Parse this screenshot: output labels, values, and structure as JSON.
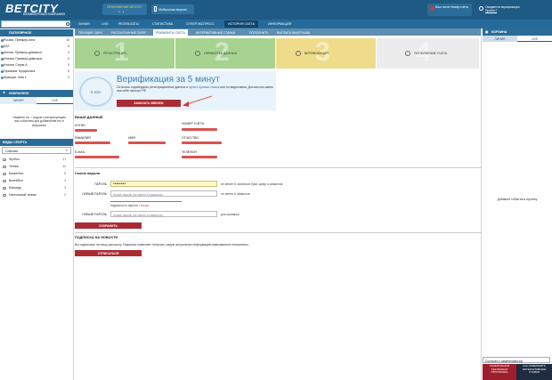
{
  "header": {
    "logo": "BETCITY",
    "logo_sub": "БУКМЕКЕРСКАЯ КОМПАНИЯ",
    "promo_label": "ПРИЛОЖЕНИЕ BETCITY",
    "mobile_label": "Мобильная версия",
    "user_text": "Ваш логин  Номер счета",
    "verify_text": "Ожидается верификация.",
    "verify_sub": "Пройти?"
  },
  "topnav": {
    "search_placeholder": "",
    "items": [
      "ЛИНИЯ",
      "LIVE",
      "РЕЗУЛЬТАТЫ",
      "СТАТИСТИКА",
      "СУПЕРЭКСПРЕСС",
      "ИСТОРИЯ СЧЁТА",
      "ИНФОРМАЦИЯ"
    ]
  },
  "subnav": {
    "items": [
      "ТЕКУЩИЕ ПАРИ",
      "РАССЧИТАННЫЕ ПАРИ",
      "РЕКВИЗИТЫ СЧЁТА",
      "ИНТЕРАКТИВНЫЕ СТАВКИ",
      "ПОПОЛНИТЬ",
      "ВЫПЛАТА ВЫИГРЫША"
    ]
  },
  "sidebar": {
    "popular_title": "ПОПУЛЯРНОЕ",
    "popular": [
      {
        "label": "Россия. Премьер-лига",
        "count": "18"
      },
      {
        "label": "КХЛ",
        "count": "8"
      },
      {
        "label": "Англия. Премьер-дивизион",
        "count": "6"
      },
      {
        "label": "Италия. Премьер-дивизион",
        "count": "6"
      },
      {
        "label": "Италия. Серия А",
        "count": "5"
      },
      {
        "label": "Германия. Бундеслига",
        "count": "5"
      },
      {
        "label": "Франция. Лига 1",
        "count": "3"
      }
    ],
    "favorites_title": "ИЗБРАННОЕ",
    "tab_line": "ЛИНИЯ",
    "tab_live": "LIVE",
    "note": "Нажмите на ☆ рядом с интересующим вас событием для добавления его в избранное",
    "sports_title": "ВИДЫ СПОРТА",
    "select_value": "События",
    "sports": [
      {
        "label": "Футбол",
        "count": "17"
      },
      {
        "label": "Теннис",
        "count": "12"
      },
      {
        "label": "Баскетбол",
        "count": "5"
      },
      {
        "label": "Волейбол",
        "count": "4"
      },
      {
        "label": "Бильярд",
        "count": "3"
      },
      {
        "label": "Настольный теннис",
        "count": "2"
      }
    ]
  },
  "steps": [
    {
      "num": "1",
      "label": "РЕГИСТРАЦИЯ",
      "color": "#a7d391"
    },
    {
      "num": "2",
      "label": "ОБРАБОТКА ДАННЫХ",
      "color": "#a7d391"
    },
    {
      "num": "3",
      "label": "ВЕРИФИКАЦИЯ",
      "color": "#efdc8a"
    },
    {
      "num": "4",
      "label": "ПОПОЛНЕНИЕ СЧЕТА",
      "color": "#ececec"
    }
  ],
  "verification": {
    "timer": "5 min",
    "title": "Верификация за 5 минут",
    "text_prefix": "Осталось подтвердить регистрационные данные в",
    "link_text": "пункте приема ставок",
    "text_suffix": "или по видеосвязи. Достаточно иметь при себе паспорт РФ",
    "button": "ЗАКАЗАТЬ ЗВОНОК"
  },
  "data": {
    "title": "ВАШИ ДАННЫЕ",
    "login": "ЛОГИН",
    "account": "НОМЕР СЧЕТА",
    "surname": "ФАМИЛИЯ",
    "name": "ИМЯ",
    "patronymic": "ОТЧЕСТВО",
    "email": "E-MAIL",
    "phone": "ТЕЛЕФОН"
  },
  "password": {
    "title": "Смена пароля",
    "current_label": "ПАРОЛЬ",
    "current_value": "••••••••",
    "current_hint": "не менее 6 латинских букв, цифр и символов",
    "new_label": "НОВЫЙ ПАРОЛЬ",
    "new_placeholder": "Новый пароль (не менее 6 символов)",
    "new_hint": "не менее 6 символов",
    "strength_label": "Надежность пароля:",
    "strength_value": "Низкая",
    "repeat_label": "НОВЫЙ ПАРОЛЬ",
    "repeat_placeholder": "Новый пароль (не менее 6 символов)",
    "repeat_hint": "для проверки",
    "save": "СОХРАНИТЬ"
  },
  "newsletter": {
    "title": "ПОДПИСКА НА НОВОСТИ",
    "text": "Вы подписаны на нашу рассылку. Подписка позволяет получать самую актуальную информацию максимально оперативно.",
    "button": "ОТПИСАТЬСЯ"
  },
  "right": {
    "title": "КОРЗИНА",
    "tab_line": "ЛИНИЯ",
    "tab_live": "LIVE",
    "empty": "Добавьте события в корзину",
    "select": "Согласен с изменением кф.",
    "banner1": "ГЕНЕРАЛЬНАЯ РЕКЛАМНАЯ ПРОГРАММА",
    "banner2": "КАК СОВЕРШИТЬ ИНТЕРАКТИВНЫЕ СТАВКИ"
  }
}
